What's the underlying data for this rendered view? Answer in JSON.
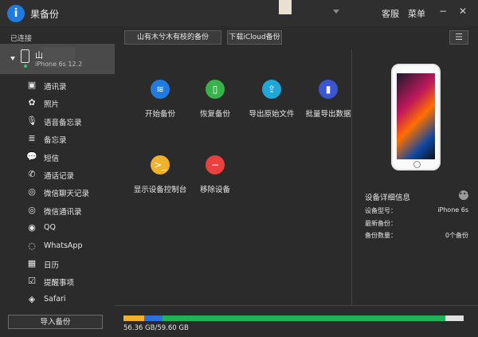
{
  "app": {
    "title": "果备份",
    "logo": "i"
  },
  "titlebar": {
    "help": "客服",
    "menu": "菜单"
  },
  "sidebar": {
    "header": "已连接",
    "device": {
      "name": "山",
      "model": "iPhone 6s 12.2"
    },
    "items": [
      {
        "label": "通讯录",
        "icon": "contacts-icon",
        "glyph": "▣"
      },
      {
        "label": "照片",
        "icon": "photos-icon",
        "glyph": "✿"
      },
      {
        "label": "语音备忘录",
        "icon": "microphone-icon",
        "glyph": "🎙"
      },
      {
        "label": "备忘录",
        "icon": "notes-icon",
        "glyph": "≣"
      },
      {
        "label": "短信",
        "icon": "message-icon",
        "glyph": "💬"
      },
      {
        "label": "通话记录",
        "icon": "phone-call-icon",
        "glyph": "✆"
      },
      {
        "label": "微信聊天记录",
        "icon": "wechat-icon",
        "glyph": "◎"
      },
      {
        "label": "微信通讯录",
        "icon": "wechat-contacts-icon",
        "glyph": "◎"
      },
      {
        "label": "QQ",
        "icon": "qq-icon",
        "glyph": "◉"
      },
      {
        "label": "WhatsApp",
        "icon": "whatsapp-icon",
        "glyph": "◌"
      },
      {
        "label": "日历",
        "icon": "calendar-icon",
        "glyph": "▦"
      },
      {
        "label": "提醒事项",
        "icon": "reminders-icon",
        "glyph": "☑"
      },
      {
        "label": "Safari",
        "icon": "safari-icon",
        "glyph": "◈"
      }
    ],
    "import_label": "导入备份"
  },
  "toolbar": {
    "backup_name": "山有木兮木有枝的备份",
    "icloud": "下载iCloud备份"
  },
  "actions": [
    {
      "label": "开始备份",
      "icon": "layers-icon",
      "glyph": "≋",
      "color": "#1f7be0"
    },
    {
      "label": "恢复备份",
      "icon": "phone-restore-icon",
      "glyph": "▯",
      "color": "#37b34a"
    },
    {
      "label": "导出原始文件",
      "icon": "upload-icon",
      "glyph": "⇪",
      "color": "#1ea7d8"
    },
    {
      "label": "批量导出数据",
      "icon": "export-batch-icon",
      "glyph": "▮",
      "color": "#3a56d4"
    },
    {
      "label": "显示设备控制台",
      "icon": "console-icon",
      "glyph": ">_",
      "color": "#f2b12a"
    },
    {
      "label": "移除设备",
      "icon": "remove-icon",
      "glyph": "−",
      "color": "#e8413f"
    }
  ],
  "detail": {
    "title": "设备详细信息",
    "rows": [
      {
        "key": "设备型号：",
        "value": "iPhone 6s"
      },
      {
        "key": "最新备份：",
        "value": ""
      },
      {
        "key": "备份数量：",
        "value": "0个备份"
      }
    ]
  },
  "storage": {
    "text": "56.36 GB/59.60 GB",
    "used_fraction": 0.9456,
    "segments": [
      {
        "name": "yellow",
        "color": "#f2b12a",
        "fraction": 0.06
      },
      {
        "name": "blue",
        "color": "#2f6fe0",
        "fraction": 0.055
      },
      {
        "name": "green",
        "color": "#1fb35a",
        "fraction": 0.83
      }
    ]
  }
}
